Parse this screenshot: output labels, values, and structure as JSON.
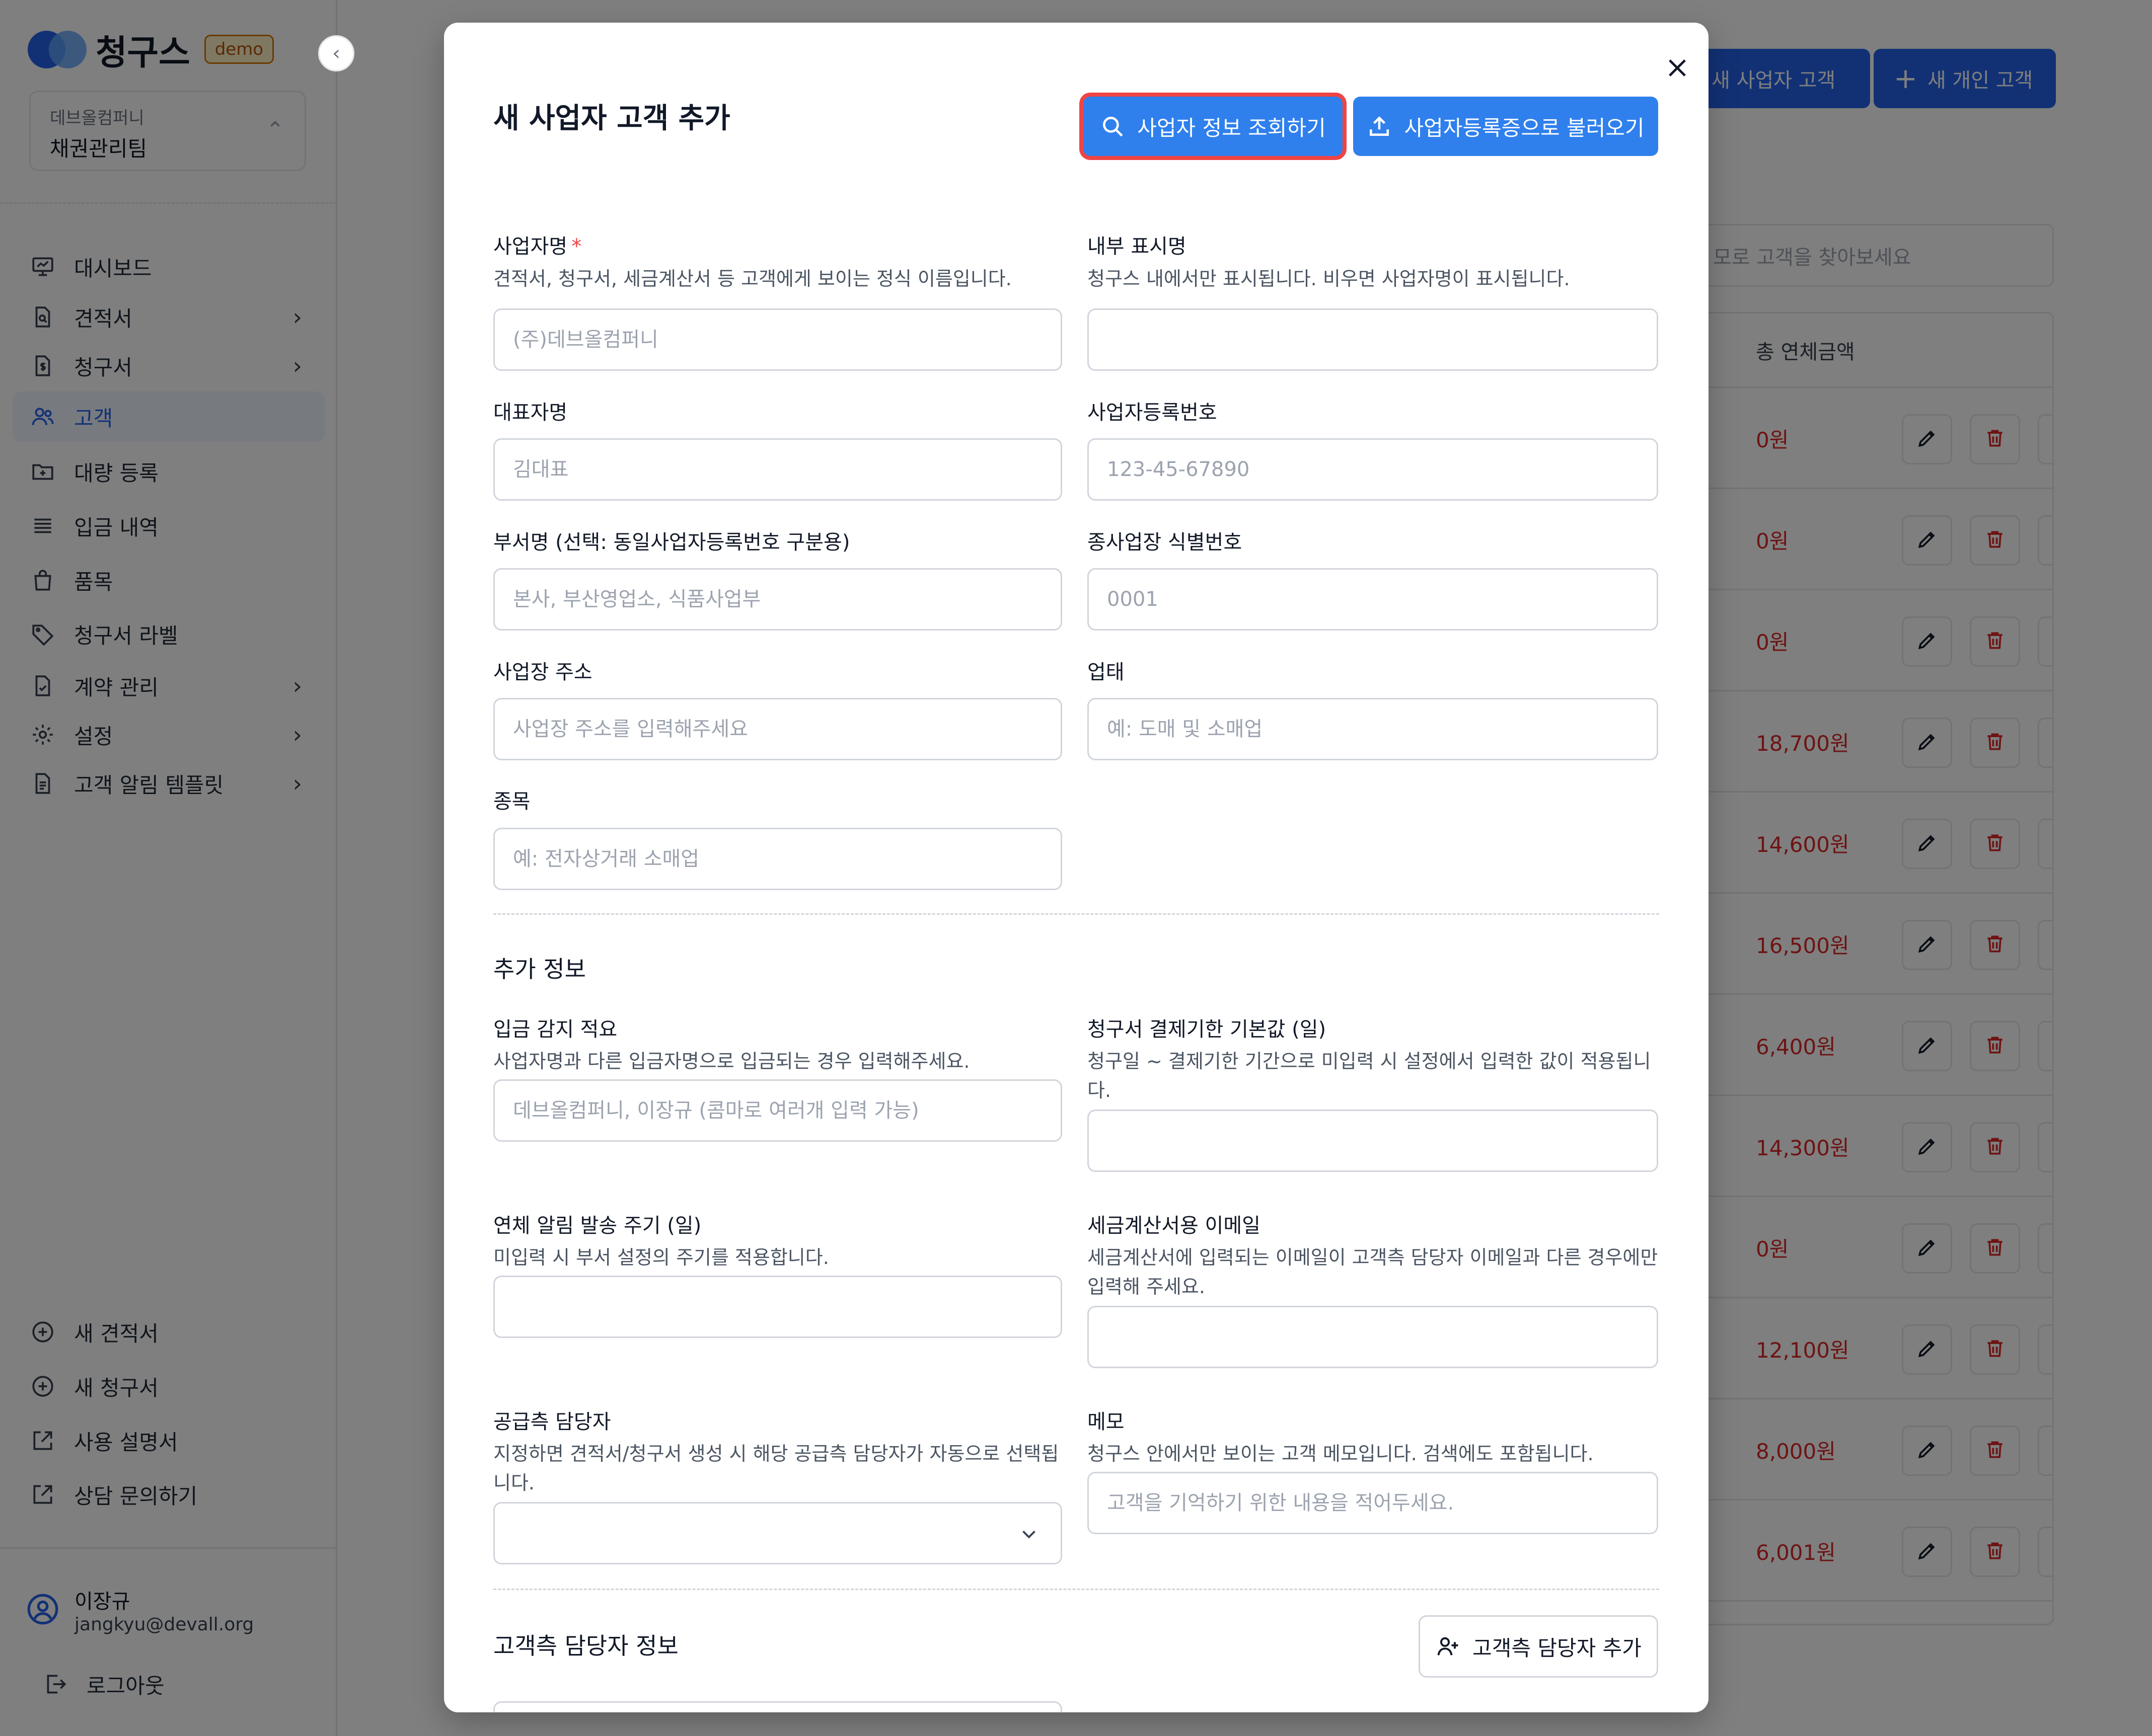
{
  "app": {
    "logo_text": "청구스",
    "badge": "demo",
    "company": "데브올컴퍼니",
    "team": "채권관리팀"
  },
  "sidebar": {
    "items": [
      {
        "label": "대시보드",
        "icon": "dashboard-icon"
      },
      {
        "label": "견적서",
        "icon": "document-search-icon"
      },
      {
        "label": "청구서",
        "icon": "invoice-dollar-icon"
      },
      {
        "label": "고객",
        "icon": "users-icon"
      },
      {
        "label": "대량 등록",
        "icon": "folder-plus-icon"
      },
      {
        "label": "입금 내역",
        "icon": "list-icon"
      },
      {
        "label": "품목",
        "icon": "shopping-bag-icon"
      },
      {
        "label": "청구서 라벨",
        "icon": "tag-icon"
      },
      {
        "label": "계약 관리",
        "icon": "contract-check-icon"
      },
      {
        "label": "설정",
        "icon": "gear-icon"
      },
      {
        "label": "고객 알림 템플릿",
        "icon": "template-doc-icon"
      }
    ],
    "bottom_items": [
      {
        "label": "새 견적서",
        "icon": "plus-circle-icon"
      },
      {
        "label": "새 청구서",
        "icon": "plus-circle-icon"
      },
      {
        "label": "사용 설명서",
        "icon": "external-link-icon"
      },
      {
        "label": "상담 문의하기",
        "icon": "external-link-icon"
      }
    ],
    "user": {
      "name": "이장규",
      "email": "jangkyu@devall.org",
      "logout": "로그아웃"
    }
  },
  "background": {
    "new_business_btn": "새 사업자 고객",
    "new_personal_btn": "새 개인 고객",
    "search_placeholder": "모로 고객을 찾아보세요",
    "col_overdue": "총 연체금액",
    "rows": [
      "0원",
      "0원",
      "0원",
      "18,700원",
      "14,600원",
      "16,500원",
      "6,400원",
      "14,300원",
      "0원",
      "12,100원",
      "8,000원",
      "6,001원"
    ]
  },
  "modal": {
    "title": "새 사업자 고객 추가",
    "lookup_btn": "사업자 정보 조회하기",
    "upload_btn": "사업자등록증으로 불러오기",
    "fields": {
      "business_name": {
        "label": "사업자명",
        "required": "*",
        "help": "견적서, 청구서, 세금계산서 등 고객에게 보이는 정식 이름입니다.",
        "placeholder": "(주)데브올컴퍼니",
        "value": ""
      },
      "display_name": {
        "label": "내부 표시명",
        "help": "청구스 내에서만 표시됩니다. 비우면 사업자명이 표시됩니다.",
        "placeholder": "",
        "value": ""
      },
      "ceo_name": {
        "label": "대표자명",
        "placeholder": "김대표",
        "value": ""
      },
      "reg_number": {
        "label": "사업자등록번호",
        "placeholder": "123-45-67890",
        "value": ""
      },
      "department": {
        "label": "부서명 (선택: 동일사업자등록번호 구분용)",
        "placeholder": "본사, 부산영업소, 식품사업부",
        "value": ""
      },
      "branch_id": {
        "label": "종사업장 식별번호",
        "placeholder": "0001",
        "value": ""
      },
      "address": {
        "label": "사업장 주소",
        "placeholder": "사업장 주소를 입력해주세요",
        "value": ""
      },
      "biz_type": {
        "label": "업태",
        "placeholder": "예: 도매 및 소매업",
        "value": ""
      },
      "biz_item": {
        "label": "종목",
        "placeholder": "예: 전자상거래 소매업",
        "value": ""
      }
    },
    "extra_section": "추가 정보",
    "extra": {
      "deposit_alias": {
        "label": "입금 감지 적요",
        "help": "사업자명과 다른 입금자명으로 입금되는 경우 입력해주세요.",
        "placeholder": "데브올컴퍼니, 이장규 (콤마로 여러개 입력 가능)",
        "value": ""
      },
      "due_default": {
        "label": "청구서 결제기한 기본값 (일)",
        "help": "청구일 ~ 결제기한 기간으로 미입력 시 설정에서 입력한 값이 적용됩니다.",
        "placeholder": "",
        "value": ""
      },
      "overdue_cycle": {
        "label": "연체 알림 발송 주기 (일)",
        "help": "미입력 시 부서 설정의 주기를 적용합니다.",
        "placeholder": "",
        "value": ""
      },
      "tax_email": {
        "label": "세금계산서용 이메일",
        "help": "세금계산서에 입력되는 이메일이 고객측 담당자 이메일과 다른 경우에만 입력해 주세요.",
        "placeholder": "",
        "value": ""
      },
      "supplier_manager": {
        "label": "공급측 담당자",
        "help": "지정하면 견적서/청구서 생성 시 해당 공급측 담당자가 자동으로 선택됩니다.",
        "selected": ""
      },
      "memo": {
        "label": "메모",
        "help": "청구스 안에서만 보이는 고객 메모입니다. 검색에도 포함됩니다.",
        "placeholder": "고객을 기억하기 위한 내용을 적어두세요.",
        "value": ""
      }
    },
    "contact_section": "고객측 담당자 정보",
    "add_contact_btn": "고객측 담당자 추가"
  },
  "colors": {
    "primary": "#2f80ed",
    "focus_ring": "#ef4444",
    "danger_text": "#dc2626",
    "active_nav_bg": "#eef4ff"
  }
}
